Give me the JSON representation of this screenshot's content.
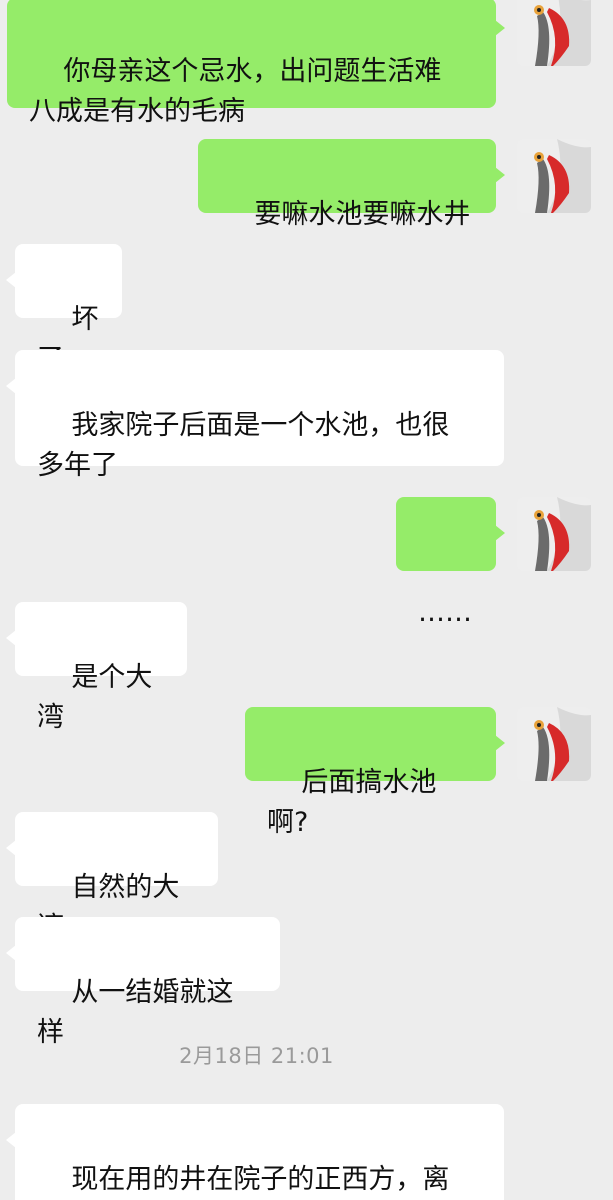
{
  "chat": {
    "messages": [
      {
        "side": "out",
        "text": "你母亲这个忌水，出问题生活难\n八成是有水的毛病",
        "avatar_icon": "pelican-avatar-icon"
      },
      {
        "side": "out",
        "text": "要嘛水池要嘛水井",
        "avatar_icon": "pelican-avatar-icon"
      },
      {
        "side": "in",
        "text": "坏了"
      },
      {
        "side": "in",
        "text": "我家院子后面是一个水池，也很\n多年了"
      },
      {
        "side": "out",
        "text": "……",
        "avatar_icon": "pelican-avatar-icon"
      },
      {
        "side": "in",
        "text": "是个大湾"
      },
      {
        "side": "out",
        "text": "后面搞水池啊?",
        "avatar_icon": "pelican-avatar-icon"
      },
      {
        "side": "in",
        "text": "自然的大湾"
      },
      {
        "side": "in",
        "text": "从一结婚就这样"
      },
      {
        "side": "in",
        "text": "现在用的井在院子的正西方，离\n主房一米半左右"
      }
    ],
    "timestamp": "2月18日 21:01"
  },
  "colors": {
    "background": "#ededed",
    "outgoing_bubble": "#95ec69",
    "incoming_bubble": "#ffffff",
    "timestamp_text": "#9a9a9a"
  }
}
